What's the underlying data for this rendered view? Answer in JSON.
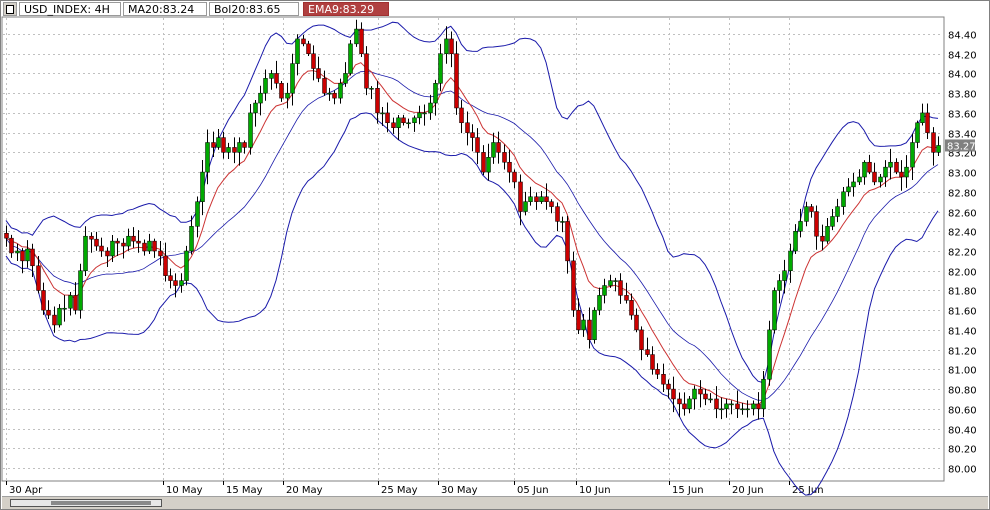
{
  "header": {
    "symbol_label": "USD_INDEX: 4H",
    "ma_label": "MA20:83.24",
    "bol_label": "Bol20:83.65",
    "ema_label": "EMA9:83.29"
  },
  "colors": {
    "up_candle": "#00aa00",
    "down_candle": "#cc0000",
    "wick": "#000000",
    "bollinger": "#1a1aaa",
    "ma20": "#cc3333",
    "grid": "#c0c0c0",
    "current_price_bg": "#808080"
  },
  "chart_data": {
    "type": "candlestick",
    "instrument": "USD_INDEX",
    "timeframe": "4H",
    "ylim": [
      79.85,
      84.65
    ],
    "y_ticks": [
      "84.40",
      "84.20",
      "84.00",
      "83.80",
      "83.60",
      "83.40",
      "83.20",
      "83.00",
      "82.80",
      "82.60",
      "82.40",
      "82.20",
      "82.00",
      "81.80",
      "81.60",
      "81.40",
      "81.20",
      "81.00",
      "80.80",
      "80.60",
      "80.40",
      "80.20",
      "80.00"
    ],
    "x_tick_labels": [
      "30 Apr",
      "10 May",
      "15 May",
      "20 May",
      "25 May",
      "30 May",
      "05 Jun",
      "10 Jun",
      "15 Jun",
      "20 Jun",
      "25 Jun"
    ],
    "current_price": "83.27",
    "grid": true,
    "close_series": [
      82.33,
      82.18,
      82.2,
      82.1,
      82.22,
      82.05,
      81.8,
      81.6,
      81.55,
      81.45,
      81.62,
      81.62,
      81.75,
      81.6,
      82.0,
      82.35,
      82.32,
      82.25,
      82.2,
      82.15,
      82.3,
      82.28,
      82.25,
      82.35,
      82.3,
      82.28,
      82.2,
      82.3,
      82.2,
      82.15,
      81.95,
      81.9,
      81.85,
      81.9,
      82.2,
      82.45,
      82.7,
      83.0,
      83.3,
      83.25,
      83.35,
      83.2,
      83.25,
      83.2,
      83.3,
      83.25,
      83.6,
      83.7,
      83.8,
      83.95,
      84.0,
      83.9,
      83.75,
      83.8,
      84.1,
      84.35,
      84.3,
      84.2,
      84.05,
      83.95,
      83.8,
      83.8,
      83.75,
      83.9,
      84.0,
      84.3,
      84.45,
      84.2,
      83.85,
      83.85,
      83.6,
      83.6,
      83.5,
      83.45,
      83.55,
      83.5,
      83.5,
      83.55,
      83.6,
      83.6,
      83.7,
      83.9,
      84.2,
      84.35,
      84.2,
      83.65,
      83.5,
      83.4,
      83.35,
      83.2,
      83.0,
      83.15,
      83.3,
      83.2,
      83.1,
      83.0,
      82.9,
      82.6,
      82.7,
      82.75,
      82.7,
      82.75,
      82.7,
      82.65,
      82.5,
      82.5,
      82.1,
      81.6,
      81.4,
      81.5,
      81.3,
      81.6,
      81.75,
      81.85,
      81.9,
      81.9,
      81.75,
      81.7,
      81.55,
      81.4,
      81.2,
      81.15,
      81.0,
      80.95,
      80.85,
      80.8,
      80.7,
      80.65,
      80.6,
      80.7,
      80.8,
      80.75,
      80.7,
      80.7,
      80.6,
      80.6,
      80.65,
      80.65,
      80.6,
      80.6,
      80.6,
      80.65,
      80.6,
      80.9,
      81.4,
      81.8,
      81.9,
      82.0,
      82.2,
      82.4,
      82.5,
      82.65,
      82.6,
      82.35,
      82.3,
      82.45,
      82.55,
      82.65,
      82.8,
      82.85,
      82.9,
      82.95,
      83.1,
      83.0,
      82.9,
      82.95,
      83.05,
      83.1,
      83.0,
      82.95,
      83.05,
      83.3,
      83.5,
      83.6,
      83.4,
      83.2,
      83.27
    ]
  }
}
